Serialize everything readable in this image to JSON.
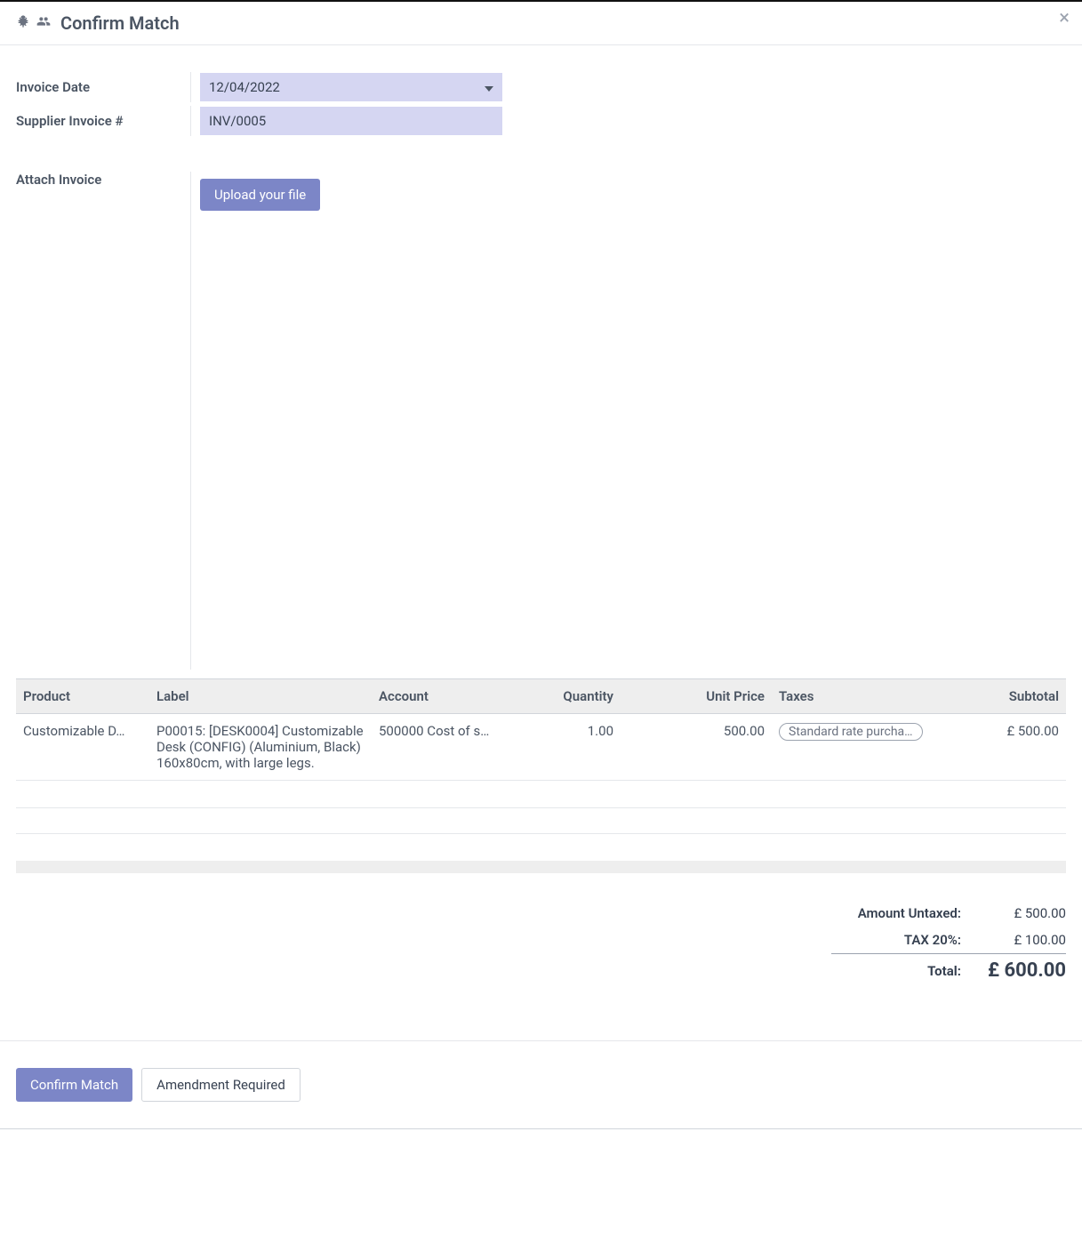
{
  "dialog": {
    "title": "Confirm Match"
  },
  "form": {
    "invoice_date_label": "Invoice Date",
    "invoice_date_value": "12/04/2022",
    "supplier_invoice_label": "Supplier Invoice #",
    "supplier_invoice_value": "INV/0005",
    "attach_invoice_label": "Attach Invoice",
    "upload_button": "Upload your file"
  },
  "table": {
    "headers": {
      "product": "Product",
      "label": "Label",
      "account": "Account",
      "quantity": "Quantity",
      "unit_price": "Unit Price",
      "taxes": "Taxes",
      "subtotal": "Subtotal"
    },
    "rows": [
      {
        "product": "Customizable D…",
        "label": "P00015: [DESK0004] Customizable Desk (CONFIG) (Aluminium, Black) 160x80cm, with large legs.",
        "account": "500000 Cost of s…",
        "quantity": "1.00",
        "unit_price": "500.00",
        "taxes": "Standard rate purcha…",
        "subtotal": "£ 500.00"
      }
    ]
  },
  "totals": {
    "untaxed_label": "Amount Untaxed:",
    "untaxed_value": "£ 500.00",
    "tax_label": "TAX 20%:",
    "tax_value": "£ 100.00",
    "total_label": "Total:",
    "total_value": "£ 600.00"
  },
  "footer": {
    "confirm": "Confirm Match",
    "amendment": "Amendment Required"
  }
}
